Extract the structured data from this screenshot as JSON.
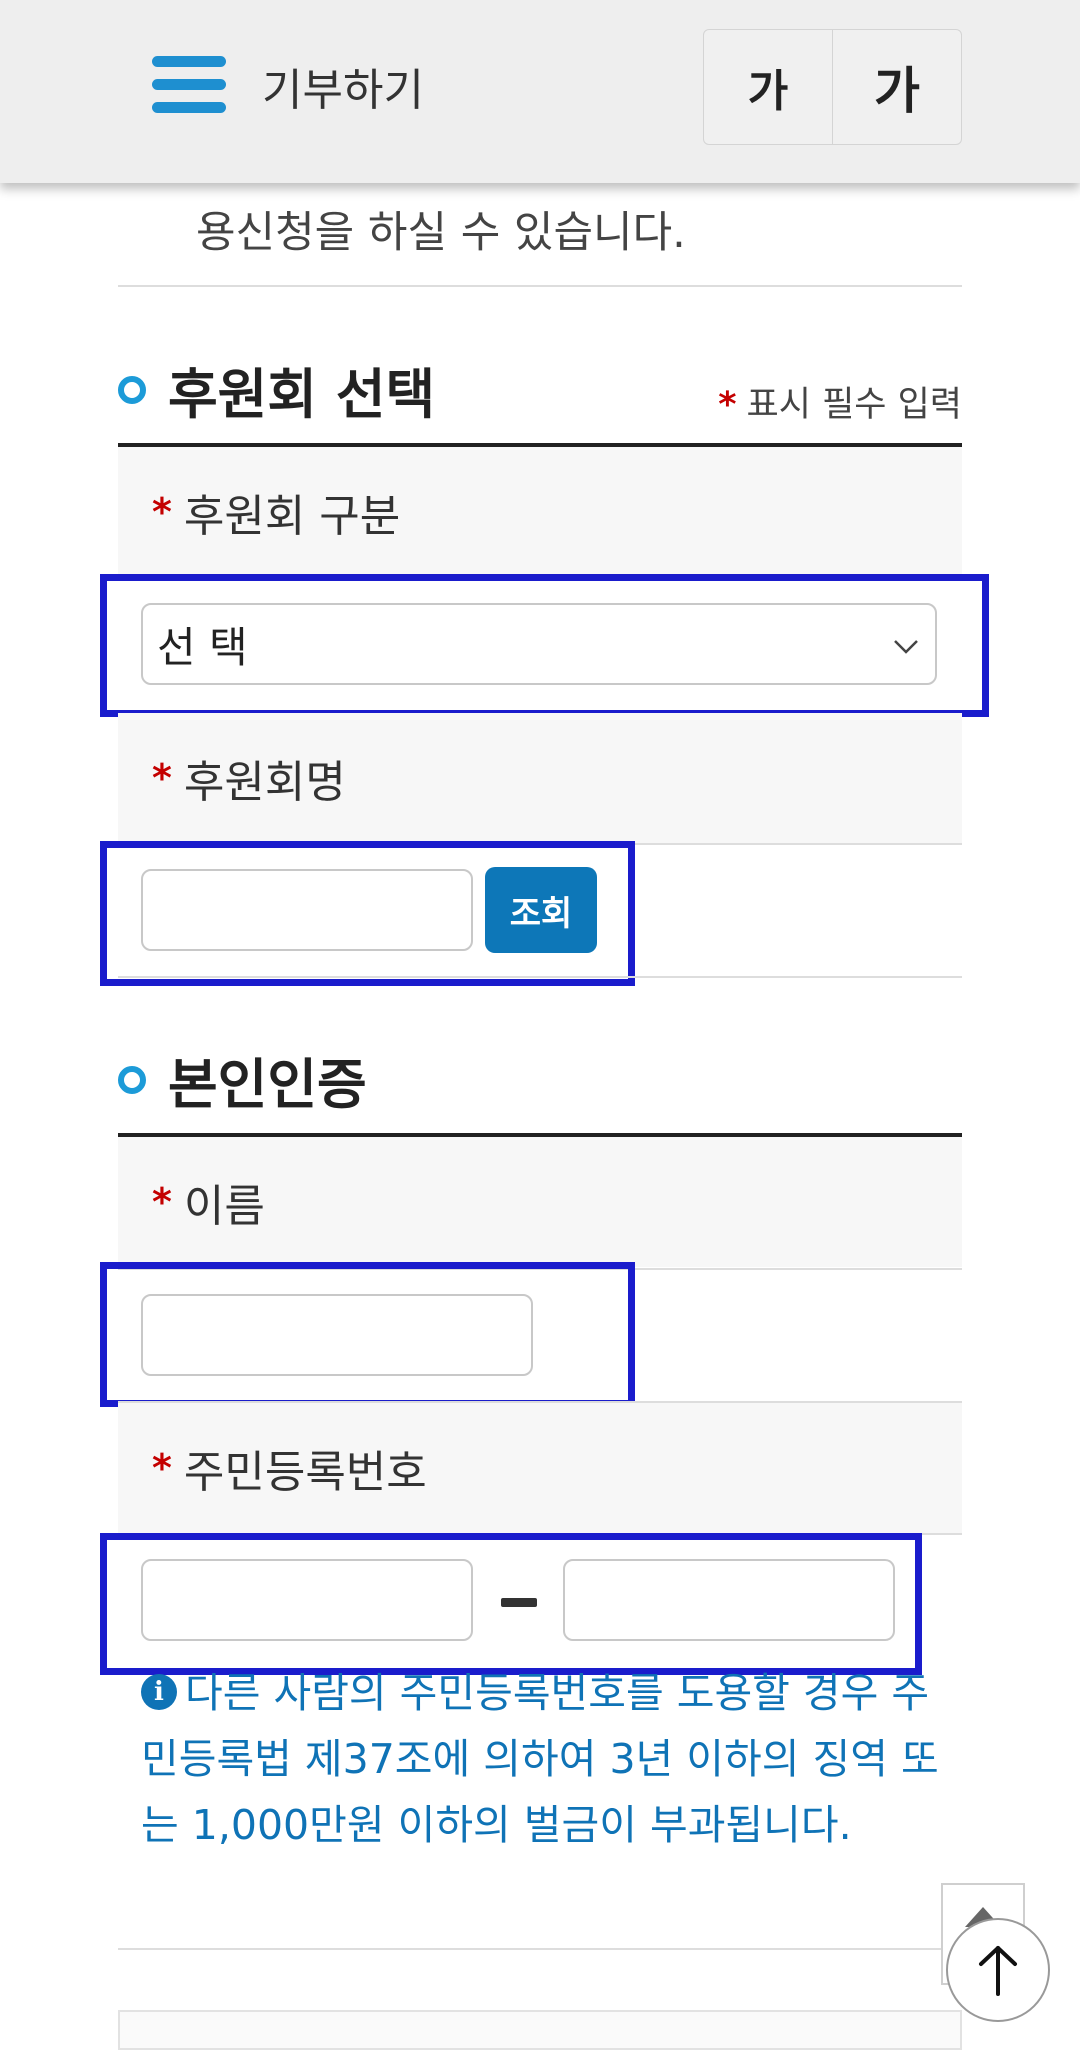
{
  "header": {
    "title": "기부하기",
    "menu_icon": "hamburger-menu-icon",
    "font_small_label": "가",
    "font_large_label": "가"
  },
  "intro": {
    "text": "용신청을 하실 수 있습니다."
  },
  "sponsor_section": {
    "title": "후원회 선택",
    "required_legend": "표시 필수 입력",
    "type_label": "후원회 구분",
    "type_select_value": "선 택",
    "name_label": "후원회명",
    "name_input_value": "",
    "search_button": "조회"
  },
  "verify_section": {
    "title": "본인인증",
    "name_label": "이름",
    "name_input_value": "",
    "rrn_label": "주민등록번호",
    "rrn_first_value": "",
    "rrn_second_value": "",
    "warning": "다른 사람의 주민등록번호를 도용할 경우 주민등록법 제37조에 의하여 3년 이하의 징역 또는 1,000만원 이하의 벌금이 부과됩니다."
  },
  "colors": {
    "accent": "#1c9bd8",
    "button": "#0d77b8",
    "info_text": "#0f73b6",
    "required": "#c40000",
    "highlight": "#1a1ccc"
  },
  "required_mark": "*"
}
